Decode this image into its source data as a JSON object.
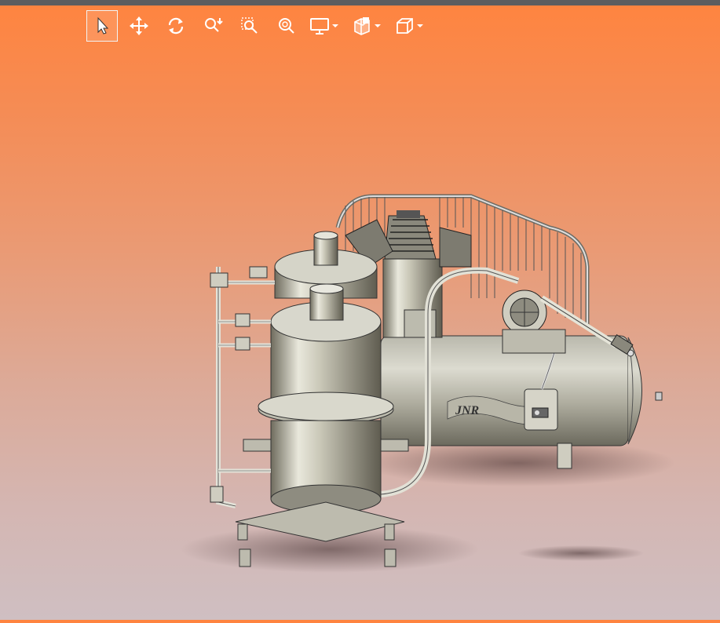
{
  "window": {
    "accent_color": "#5d5d5f",
    "background_top": "#ff843f",
    "background_bottom": "#cfbfc2"
  },
  "toolbar": {
    "tools": [
      {
        "name": "select",
        "icon": "arrow-cursor-icon",
        "active": true
      },
      {
        "name": "pan",
        "icon": "move-arrows-icon",
        "active": false
      },
      {
        "name": "rotate",
        "icon": "rotate-icon",
        "active": false
      },
      {
        "name": "zoom",
        "icon": "zoom-in-out-icon",
        "active": false
      },
      {
        "name": "zoom-area",
        "icon": "zoom-area-icon",
        "active": false
      },
      {
        "name": "zoom-fit",
        "icon": "zoom-fit-icon",
        "active": false
      },
      {
        "name": "display",
        "icon": "monitor-icon",
        "active": false,
        "dropdown": true
      },
      {
        "name": "section",
        "icon": "section-view-icon",
        "active": false,
        "dropdown": true
      },
      {
        "name": "view-orientation",
        "icon": "cube-icon",
        "active": false,
        "dropdown": true
      }
    ]
  },
  "model": {
    "nameplate": "JNR"
  }
}
